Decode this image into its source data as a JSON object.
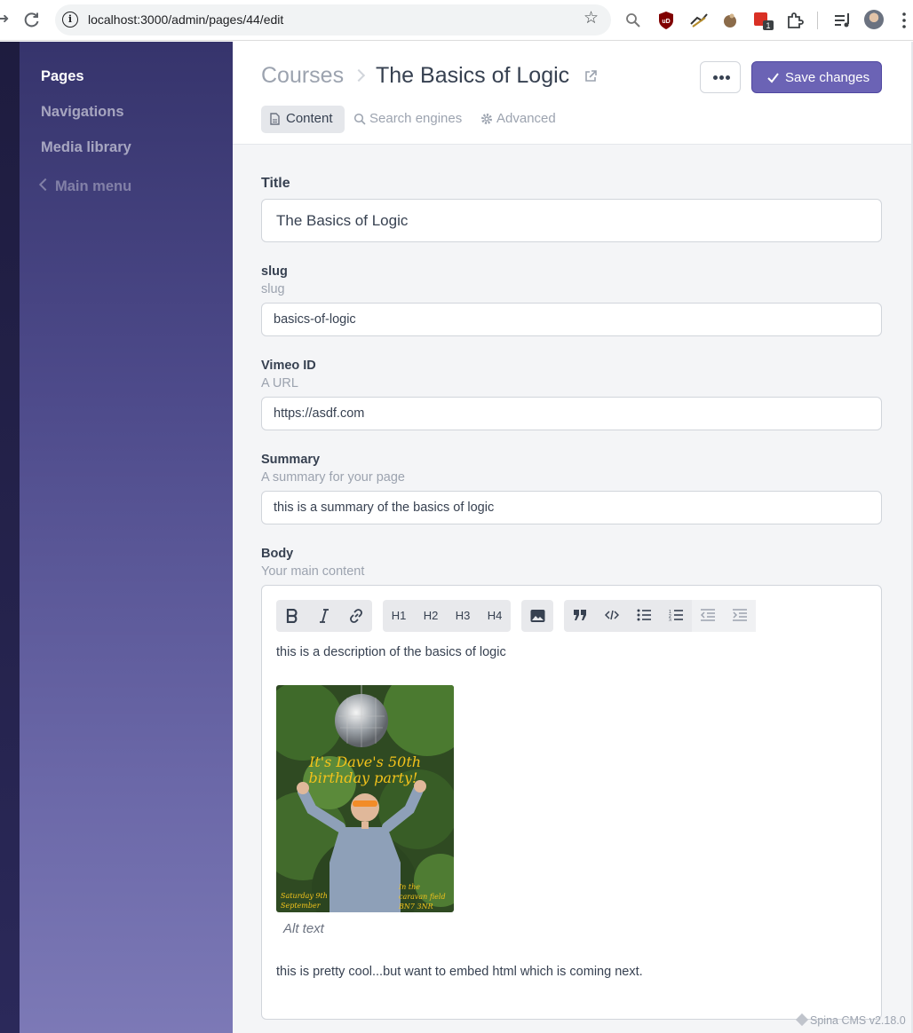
{
  "browser": {
    "url": "localhost:3000/admin/pages/44/edit",
    "ext_badge_count": "1"
  },
  "sidebar": {
    "items": [
      {
        "label": "Pages"
      },
      {
        "label": "Navigations"
      },
      {
        "label": "Media library"
      }
    ],
    "back_label": "Main menu"
  },
  "header": {
    "breadcrumb": "Courses",
    "title": "The Basics of Logic",
    "more_label": "•••",
    "save_label": "Save changes",
    "tabs": [
      {
        "label": "Content"
      },
      {
        "label": "Search engines"
      },
      {
        "label": "Advanced"
      }
    ]
  },
  "form": {
    "title": {
      "label": "Title",
      "value": "The Basics of Logic"
    },
    "slug": {
      "label": "slug",
      "help": "slug",
      "value": "basics-of-logic"
    },
    "vimeo": {
      "label": "Vimeo ID",
      "help": "A URL",
      "value": "https://asdf.com"
    },
    "summary": {
      "label": "Summary",
      "help": "A summary for your page",
      "value": "this is a summary of the basics of logic"
    },
    "body": {
      "label": "Body",
      "help": "Your main content",
      "toolbar": {
        "h1": "H1",
        "h2": "H2",
        "h3": "H3",
        "h4": "H4"
      },
      "paragraph_1": "this is a description of the basics of logic",
      "image": {
        "text_line1": "It's Dave's 50th",
        "text_line2": "birthday party!",
        "date_line1": "Saturday 9th",
        "date_line2": "September",
        "place_line1": "In the",
        "place_line2": "caravan field",
        "place_line3": "BN7 3NR"
      },
      "image_caption": "Alt text",
      "paragraph_2": "this is pretty cool...but want to embed html which is coming next."
    }
  },
  "footer": {
    "version": "Spina CMS v2.18.0"
  },
  "colors": {
    "accent": "#6b63b5",
    "sidebar_top": "#36346c",
    "sidebar_bottom": "#7c79b6"
  }
}
